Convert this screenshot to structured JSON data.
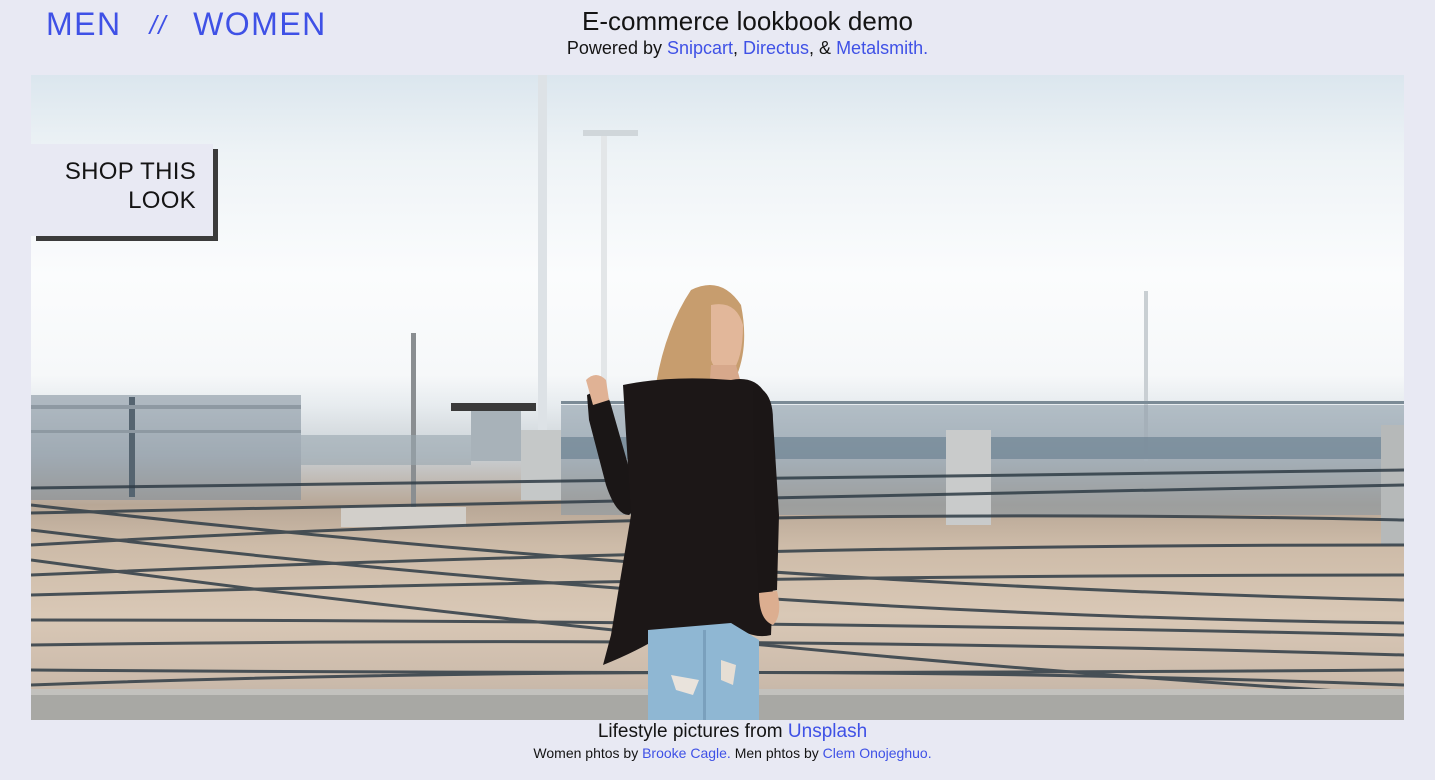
{
  "nav": {
    "men_label": "MEN",
    "separator": "//",
    "women_label": "WOMEN"
  },
  "header": {
    "title": "E-commerce lookbook demo",
    "powered_by": "Powered by ",
    "link1": "Snipcart",
    "sep1": ", ",
    "link2": "Directus",
    "sep2": ", & ",
    "link3": "Metalsmith."
  },
  "hero": {
    "shop_line1": "SHOP THIS",
    "shop_line2": "LOOK"
  },
  "footer": {
    "credits_prefix": "Lifestyle pictures from ",
    "credits_link": "Unsplash",
    "women_prefix": "Women phtos by ",
    "women_link": "Brooke Cagle.",
    "men_prefix": " Men phtos by ",
    "men_link": "Clem Onojeghuo."
  },
  "colors": {
    "background": "#e8e9f3",
    "link": "#3f51e6",
    "text": "#141414",
    "button_shadow": "#3b3b3b"
  }
}
